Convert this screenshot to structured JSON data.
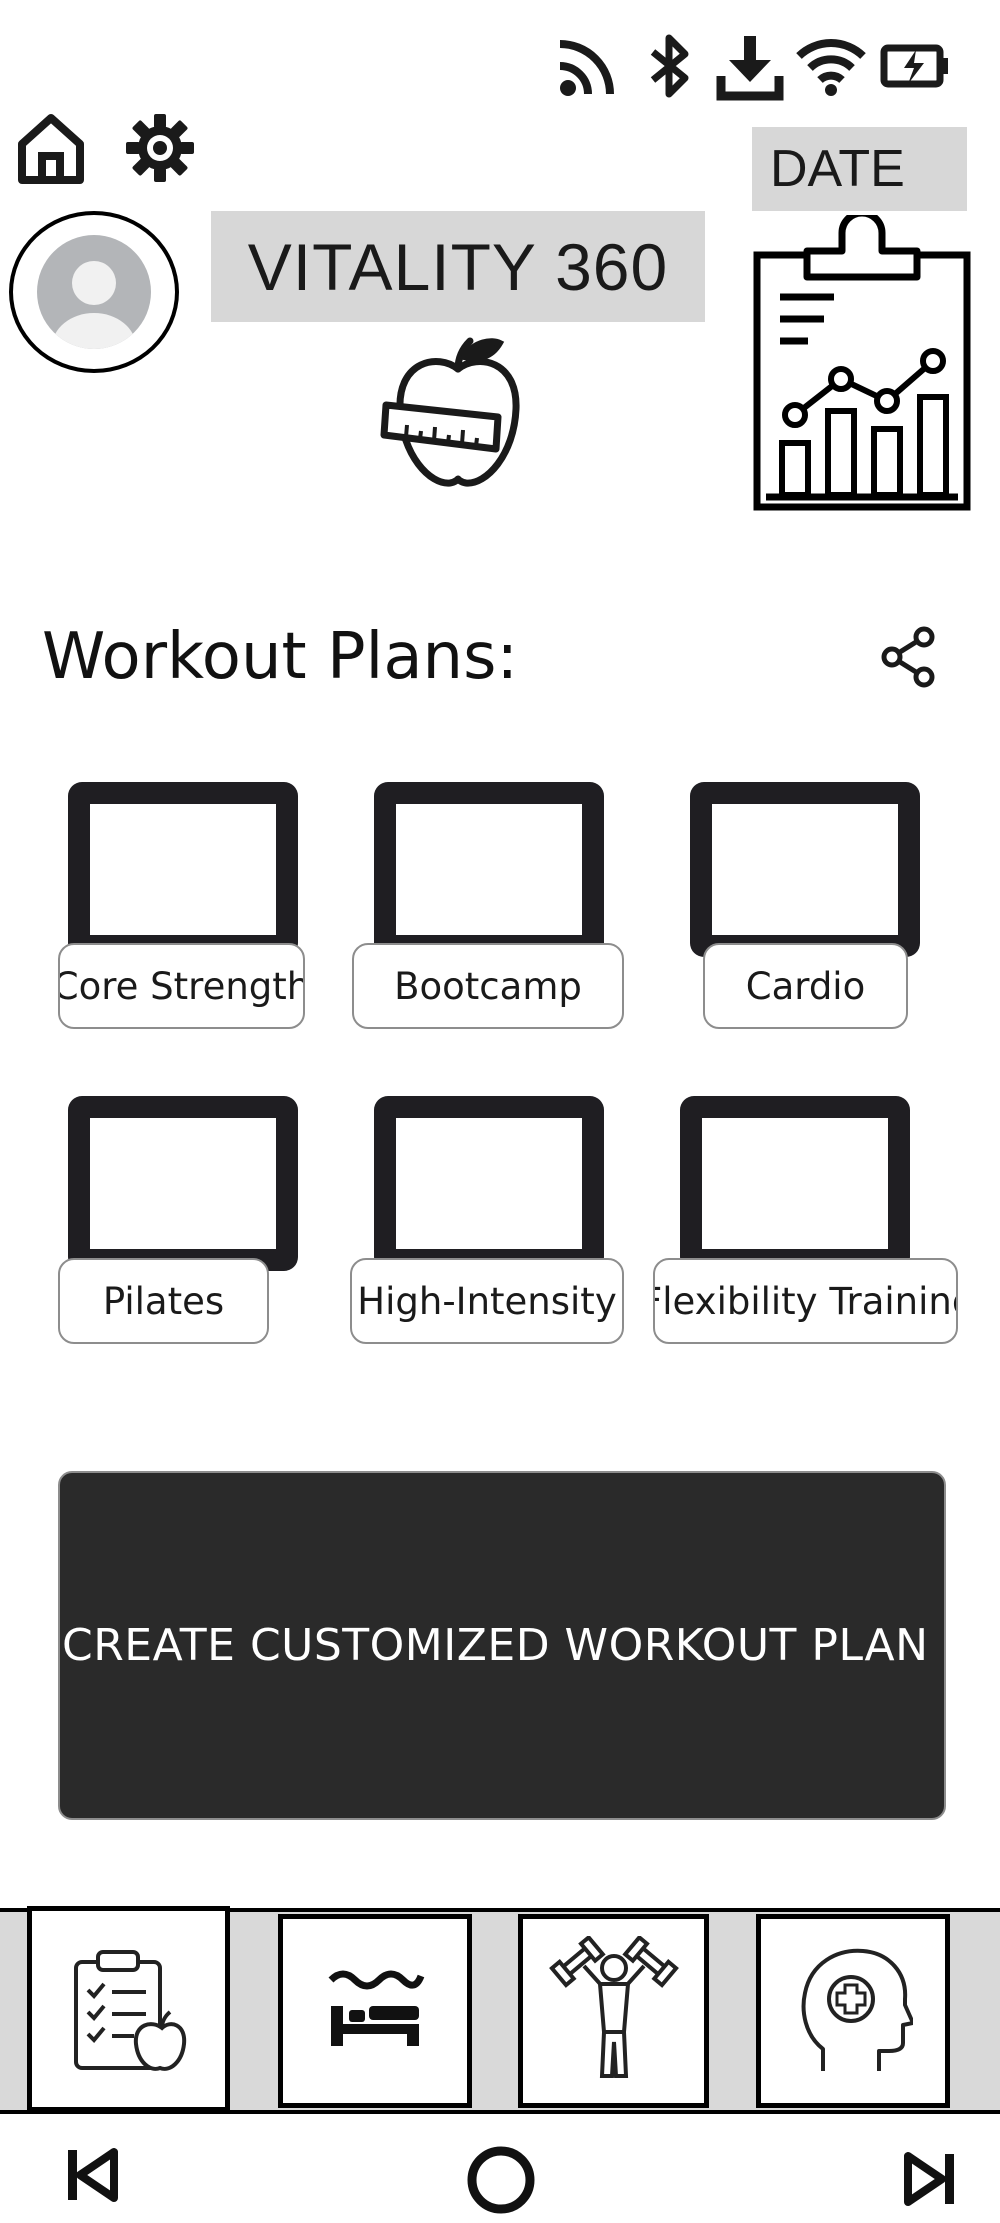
{
  "status_bar": {
    "icons": [
      "cast-icon",
      "bluetooth-icon",
      "download-icon",
      "wifi-icon",
      "battery-charging-icon"
    ]
  },
  "header": {
    "app_title": "VITALITY 360",
    "date_label": "DATE",
    "icons": [
      "home-icon",
      "gear-icon",
      "avatar",
      "apple-measuring-tape-icon",
      "clipboard-chart-icon"
    ]
  },
  "section": {
    "title": "Workout Plans:",
    "share_icon": "share-icon"
  },
  "plans": [
    {
      "label": "Core Strength"
    },
    {
      "label": "Bootcamp"
    },
    {
      "label": "Cardio"
    },
    {
      "label": "Pilates"
    },
    {
      "label": "High-Intensity"
    },
    {
      "label": "Flexibility Training"
    }
  ],
  "cta": {
    "label": "CREATE CUSTOMIZED WORKOUT PLAN"
  },
  "bottom_nav": {
    "tabs": [
      {
        "icon": "meal-plan-checklist-icon",
        "selected": true
      },
      {
        "icon": "sleep-bed-icon",
        "selected": false
      },
      {
        "icon": "fitness-dumbbell-person-icon",
        "selected": false
      },
      {
        "icon": "mental-health-head-icon",
        "selected": false
      }
    ]
  },
  "system_nav": {
    "icons": [
      "skip-previous-icon",
      "home-circle-icon",
      "skip-next-icon"
    ]
  },
  "colors": {
    "primary_dark": "#2a2a2a",
    "label_grey": "#d7d7d7",
    "frame_dark": "#1f1e22",
    "nav_strip": "#d9d9d9"
  }
}
